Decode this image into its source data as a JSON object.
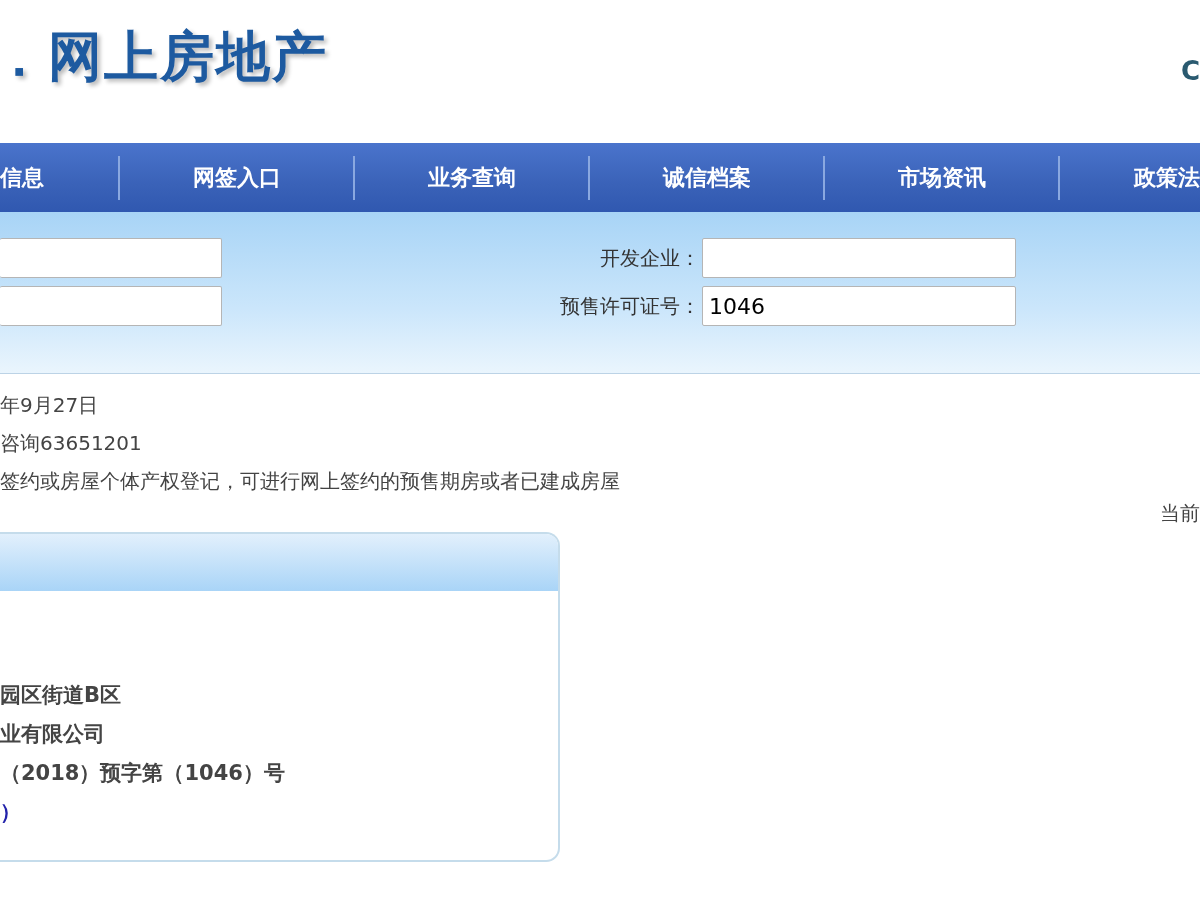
{
  "header": {
    "logo_text": "．网上房地产",
    "corner_text": "C"
  },
  "nav": [
    {
      "label": "信息",
      "kind": "edge"
    },
    {
      "label": "网签入口",
      "kind": "full"
    },
    {
      "label": "业务查询",
      "kind": "full"
    },
    {
      "label": "诚信档案",
      "kind": "full"
    },
    {
      "label": "市场资讯",
      "kind": "full"
    },
    {
      "label": "政策法",
      "kind": "edge"
    }
  ],
  "search": {
    "left_fields": [
      {
        "kind": "text"
      },
      {
        "kind": "text"
      }
    ],
    "right_fields": [
      {
        "label": "开发企业："
      },
      {
        "label": "预售许可证号：",
        "value": "1046"
      }
    ]
  },
  "notes": [
    "年9月27日",
    "咨询63651201",
    "签约或房屋个体产权登记，可进行网上签约的预售期房或者已建成房屋"
  ],
  "page_indicator": "当前",
  "card": {
    "lines": [
      {
        "text": "园区街道B区",
        "kind": "plain"
      },
      {
        "text": "业有限公司",
        "kind": "plain"
      },
      {
        "text": "（2018）预字第（1046）号",
        "kind": "plain"
      },
      {
        "text": "）",
        "kind": "link"
      }
    ]
  }
}
